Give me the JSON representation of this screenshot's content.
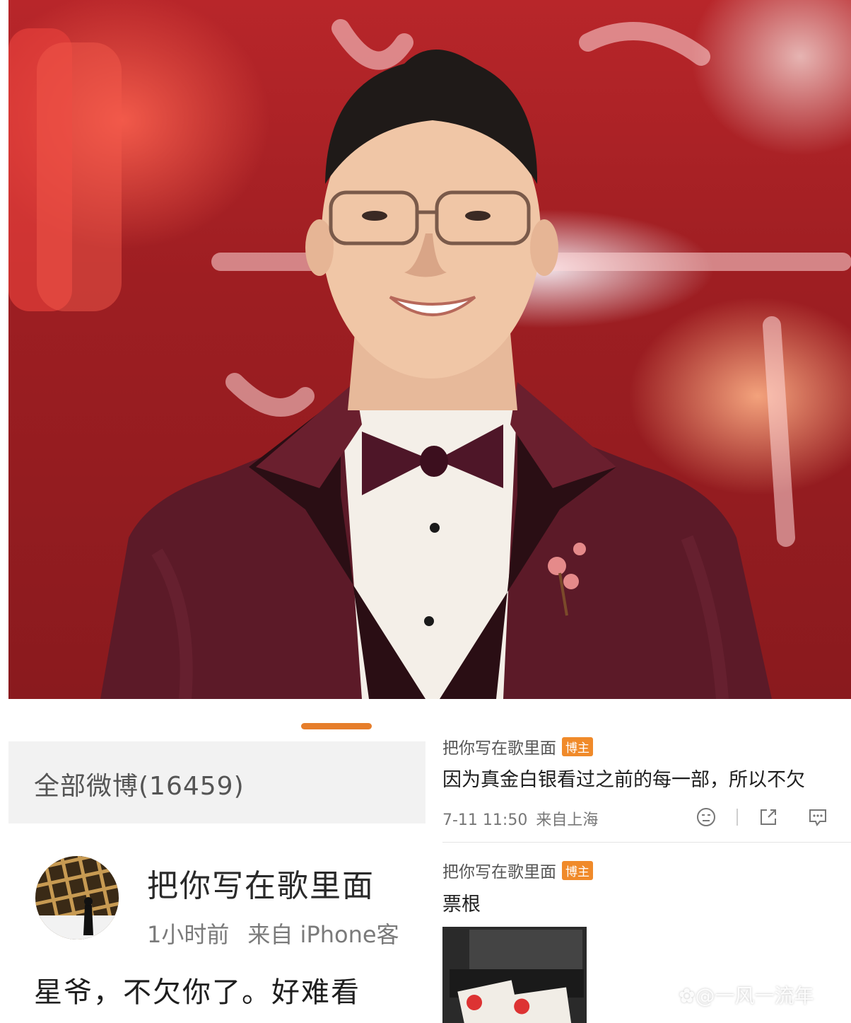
{
  "main_post": {
    "all_weibo_label": "全部微博(16459)",
    "username": "把你写在歌里面",
    "time": "1小时前",
    "source": "来自 iPhone客",
    "text": "星爷，不欠你了。好难看"
  },
  "comments": [
    {
      "username": "把你写在歌里面",
      "badge": "博主",
      "text": "因为真金白银看过之前的每一部，所以不欠",
      "time": "7-11 11:50",
      "location": "来自上海"
    },
    {
      "username": "把你写在歌里面",
      "badge": "博主",
      "text": "票根"
    }
  ],
  "watermark": "@一风一流年",
  "colors": {
    "accent_orange": "#e67e2b",
    "badge_orange": "#f08a2a",
    "photo_background_red": "#9e1e22",
    "suit_burgundy": "#5a1a26"
  },
  "icons": [
    "emoji-icon",
    "share-icon",
    "comment-icon",
    "wechat-like-paw-icon"
  ]
}
